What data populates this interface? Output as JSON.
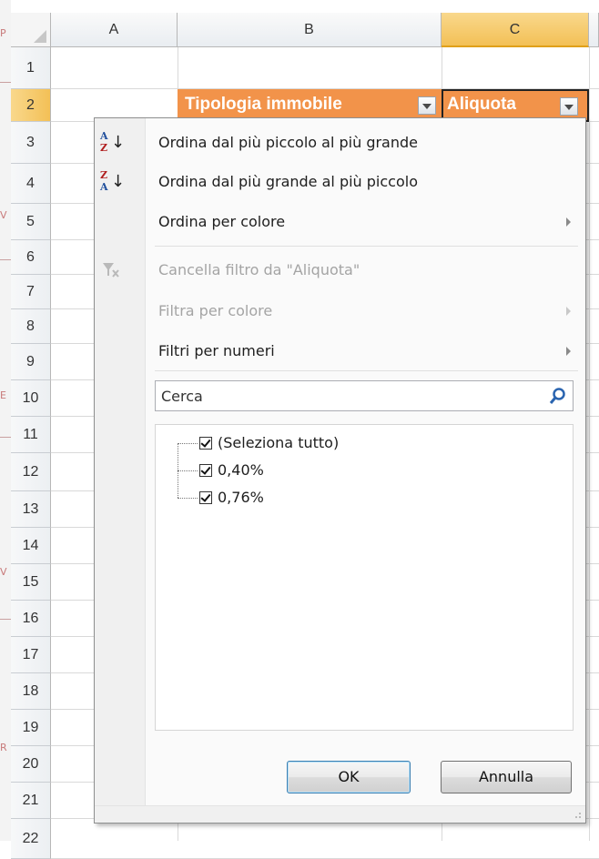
{
  "columns": [
    "A",
    "B",
    "C"
  ],
  "rows": [
    "1",
    "2",
    "3",
    "4",
    "5",
    "6",
    "7",
    "8",
    "9",
    "10",
    "11",
    "12",
    "13",
    "14",
    "15",
    "16",
    "17",
    "18",
    "19",
    "20",
    "21",
    "22"
  ],
  "cells": {
    "b2": "Tipologia immobile",
    "c2": "Aliquota"
  },
  "left_strip_letters": [
    "P",
    "V",
    "E",
    "V",
    "R"
  ],
  "menu": {
    "sort_asc": "Ordina dal più piccolo al più grande",
    "sort_desc": "Ordina dal più grande al più piccolo",
    "sort_color": "Ordina per colore",
    "clear_filter": "Cancella filtro da \"Aliquota\"",
    "filter_color": "Filtra per colore",
    "number_filters": "Filtri per numeri",
    "sort_asc_icon_top": "A",
    "sort_asc_icon_bottom": "Z",
    "sort_desc_icon_top": "Z",
    "sort_desc_icon_bottom": "A"
  },
  "search": {
    "placeholder": "Cerca"
  },
  "values_list": [
    {
      "label": "(Seleziona tutto)",
      "checked": true
    },
    {
      "label": "0,40%",
      "checked": true
    },
    {
      "label": "0,76%",
      "checked": true
    }
  ],
  "buttons": {
    "ok": "OK",
    "cancel": "Annulla"
  },
  "colors": {
    "header_fill": "#f2934a",
    "selected_header": "#f3c056"
  }
}
